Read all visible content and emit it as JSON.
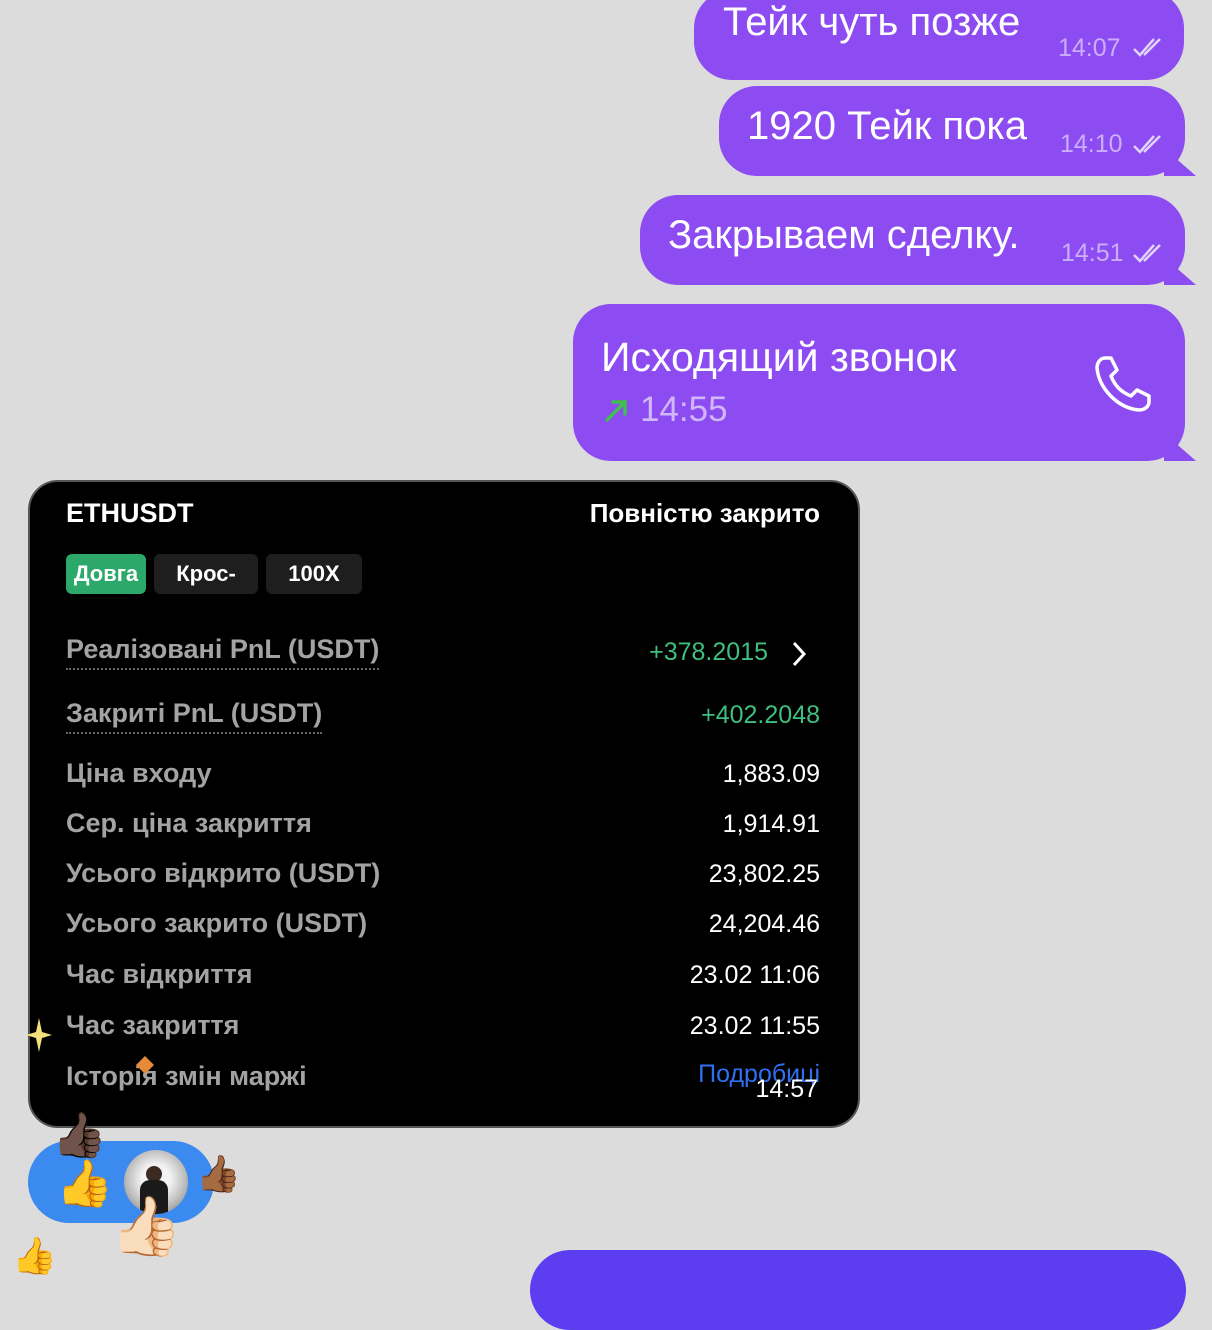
{
  "messages": [
    {
      "text": "Тейк чуть позже",
      "time": "14:07"
    },
    {
      "text": "1920 Тейк пока",
      "time": "14:10"
    },
    {
      "text": "Закрываем сделку.",
      "time": "14:51"
    }
  ],
  "call": {
    "title": "Исходящий звонок",
    "time": "14:55",
    "icon": "phone-icon",
    "arrow_color": "#3fbf4f"
  },
  "trade_card": {
    "symbol": "ETHUSDT",
    "status": "Повністю закрито",
    "tags": [
      "Довга",
      "Крос-",
      "100X"
    ],
    "rows": [
      {
        "label": "Реалізовані PnL (USDT)",
        "value": "+378.2015"
      },
      {
        "label": "Закриті PnL (USDT)",
        "value": "+402.2048"
      },
      {
        "label": "Ціна входу",
        "value": "1,883.09"
      },
      {
        "label": "Сер. ціна закриття",
        "value": "1,914.91"
      },
      {
        "label": "Усього відкрито (USDT)",
        "value": "23,802.25"
      },
      {
        "label": "Усього закрито (USDT)",
        "value": "24,204.46"
      },
      {
        "label": "Час відкриття",
        "value": "23.02 11:06"
      },
      {
        "label": "Час закриття",
        "value": "23.02 11:55"
      },
      {
        "label": "Історія змін маржі",
        "value": "Подробиці"
      }
    ],
    "time": "14:57"
  },
  "reactions": {
    "emoji": "👍"
  },
  "colors": {
    "outgoing_bubble": "#8c4cf2",
    "profit_green": "#3fbf7f",
    "link_blue": "#2f6ff0",
    "reaction_bubble": "#3b8af0"
  }
}
